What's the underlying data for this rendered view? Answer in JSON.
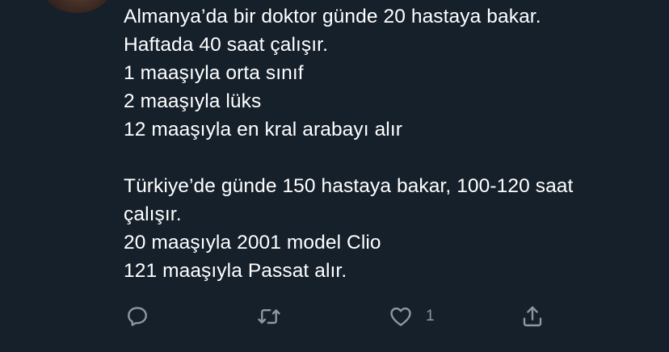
{
  "tweet": {
    "lines": [
      "Almanya’da bir doktor günde 20 hastaya bakar.",
      "Haftada 40 saat çalışır.",
      "1 maaşıyla orta sınıf",
      "2 maaşıyla lüks",
      "12 maaşıyla en kral arabayı alır",
      "",
      "Türkiye’de günde 150 hastaya bakar, 100-120 saat",
      "çalışır.",
      "20 maaşıyla 2001 model Clio",
      "121 maaşıyla Passat alır."
    ]
  },
  "actions": {
    "reply_icon": "reply-icon",
    "retweet_icon": "retweet-icon",
    "like_icon": "heart-icon",
    "like_count": "1",
    "share_icon": "share-icon"
  },
  "colors": {
    "background": "#15202b",
    "text": "#ffffff",
    "icon": "#8b98a5"
  }
}
